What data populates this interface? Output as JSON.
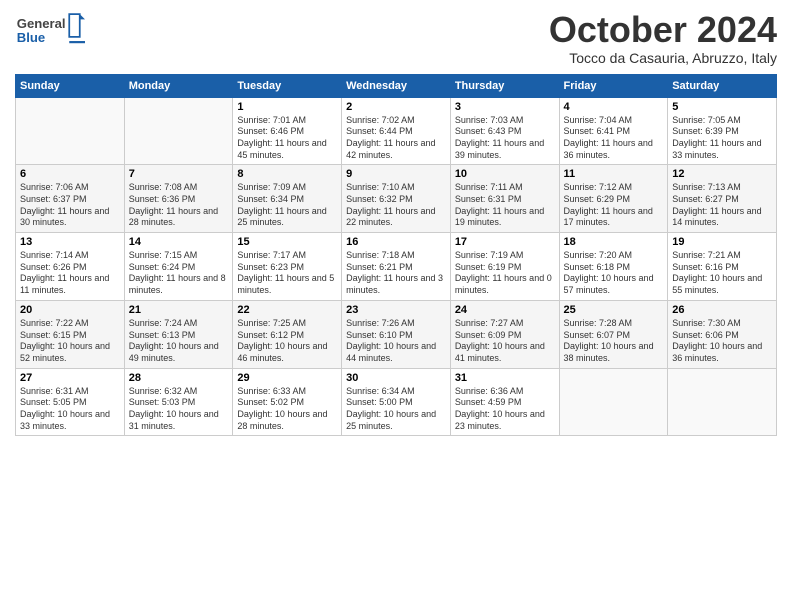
{
  "header": {
    "logo_general": "General",
    "logo_blue": "Blue",
    "month_title": "October 2024",
    "location": "Tocco da Casauria, Abruzzo, Italy"
  },
  "weekdays": [
    "Sunday",
    "Monday",
    "Tuesday",
    "Wednesday",
    "Thursday",
    "Friday",
    "Saturday"
  ],
  "weeks": [
    [
      {
        "day": "",
        "info": ""
      },
      {
        "day": "",
        "info": ""
      },
      {
        "day": "1",
        "info": "Sunrise: 7:01 AM\nSunset: 6:46 PM\nDaylight: 11 hours and 45 minutes."
      },
      {
        "day": "2",
        "info": "Sunrise: 7:02 AM\nSunset: 6:44 PM\nDaylight: 11 hours and 42 minutes."
      },
      {
        "day": "3",
        "info": "Sunrise: 7:03 AM\nSunset: 6:43 PM\nDaylight: 11 hours and 39 minutes."
      },
      {
        "day": "4",
        "info": "Sunrise: 7:04 AM\nSunset: 6:41 PM\nDaylight: 11 hours and 36 minutes."
      },
      {
        "day": "5",
        "info": "Sunrise: 7:05 AM\nSunset: 6:39 PM\nDaylight: 11 hours and 33 minutes."
      }
    ],
    [
      {
        "day": "6",
        "info": "Sunrise: 7:06 AM\nSunset: 6:37 PM\nDaylight: 11 hours and 30 minutes."
      },
      {
        "day": "7",
        "info": "Sunrise: 7:08 AM\nSunset: 6:36 PM\nDaylight: 11 hours and 28 minutes."
      },
      {
        "day": "8",
        "info": "Sunrise: 7:09 AM\nSunset: 6:34 PM\nDaylight: 11 hours and 25 minutes."
      },
      {
        "day": "9",
        "info": "Sunrise: 7:10 AM\nSunset: 6:32 PM\nDaylight: 11 hours and 22 minutes."
      },
      {
        "day": "10",
        "info": "Sunrise: 7:11 AM\nSunset: 6:31 PM\nDaylight: 11 hours and 19 minutes."
      },
      {
        "day": "11",
        "info": "Sunrise: 7:12 AM\nSunset: 6:29 PM\nDaylight: 11 hours and 17 minutes."
      },
      {
        "day": "12",
        "info": "Sunrise: 7:13 AM\nSunset: 6:27 PM\nDaylight: 11 hours and 14 minutes."
      }
    ],
    [
      {
        "day": "13",
        "info": "Sunrise: 7:14 AM\nSunset: 6:26 PM\nDaylight: 11 hours and 11 minutes."
      },
      {
        "day": "14",
        "info": "Sunrise: 7:15 AM\nSunset: 6:24 PM\nDaylight: 11 hours and 8 minutes."
      },
      {
        "day": "15",
        "info": "Sunrise: 7:17 AM\nSunset: 6:23 PM\nDaylight: 11 hours and 5 minutes."
      },
      {
        "day": "16",
        "info": "Sunrise: 7:18 AM\nSunset: 6:21 PM\nDaylight: 11 hours and 3 minutes."
      },
      {
        "day": "17",
        "info": "Sunrise: 7:19 AM\nSunset: 6:19 PM\nDaylight: 11 hours and 0 minutes."
      },
      {
        "day": "18",
        "info": "Sunrise: 7:20 AM\nSunset: 6:18 PM\nDaylight: 10 hours and 57 minutes."
      },
      {
        "day": "19",
        "info": "Sunrise: 7:21 AM\nSunset: 6:16 PM\nDaylight: 10 hours and 55 minutes."
      }
    ],
    [
      {
        "day": "20",
        "info": "Sunrise: 7:22 AM\nSunset: 6:15 PM\nDaylight: 10 hours and 52 minutes."
      },
      {
        "day": "21",
        "info": "Sunrise: 7:24 AM\nSunset: 6:13 PM\nDaylight: 10 hours and 49 minutes."
      },
      {
        "day": "22",
        "info": "Sunrise: 7:25 AM\nSunset: 6:12 PM\nDaylight: 10 hours and 46 minutes."
      },
      {
        "day": "23",
        "info": "Sunrise: 7:26 AM\nSunset: 6:10 PM\nDaylight: 10 hours and 44 minutes."
      },
      {
        "day": "24",
        "info": "Sunrise: 7:27 AM\nSunset: 6:09 PM\nDaylight: 10 hours and 41 minutes."
      },
      {
        "day": "25",
        "info": "Sunrise: 7:28 AM\nSunset: 6:07 PM\nDaylight: 10 hours and 38 minutes."
      },
      {
        "day": "26",
        "info": "Sunrise: 7:30 AM\nSunset: 6:06 PM\nDaylight: 10 hours and 36 minutes."
      }
    ],
    [
      {
        "day": "27",
        "info": "Sunrise: 6:31 AM\nSunset: 5:05 PM\nDaylight: 10 hours and 33 minutes."
      },
      {
        "day": "28",
        "info": "Sunrise: 6:32 AM\nSunset: 5:03 PM\nDaylight: 10 hours and 31 minutes."
      },
      {
        "day": "29",
        "info": "Sunrise: 6:33 AM\nSunset: 5:02 PM\nDaylight: 10 hours and 28 minutes."
      },
      {
        "day": "30",
        "info": "Sunrise: 6:34 AM\nSunset: 5:00 PM\nDaylight: 10 hours and 25 minutes."
      },
      {
        "day": "31",
        "info": "Sunrise: 6:36 AM\nSunset: 4:59 PM\nDaylight: 10 hours and 23 minutes."
      },
      {
        "day": "",
        "info": ""
      },
      {
        "day": "",
        "info": ""
      }
    ]
  ]
}
